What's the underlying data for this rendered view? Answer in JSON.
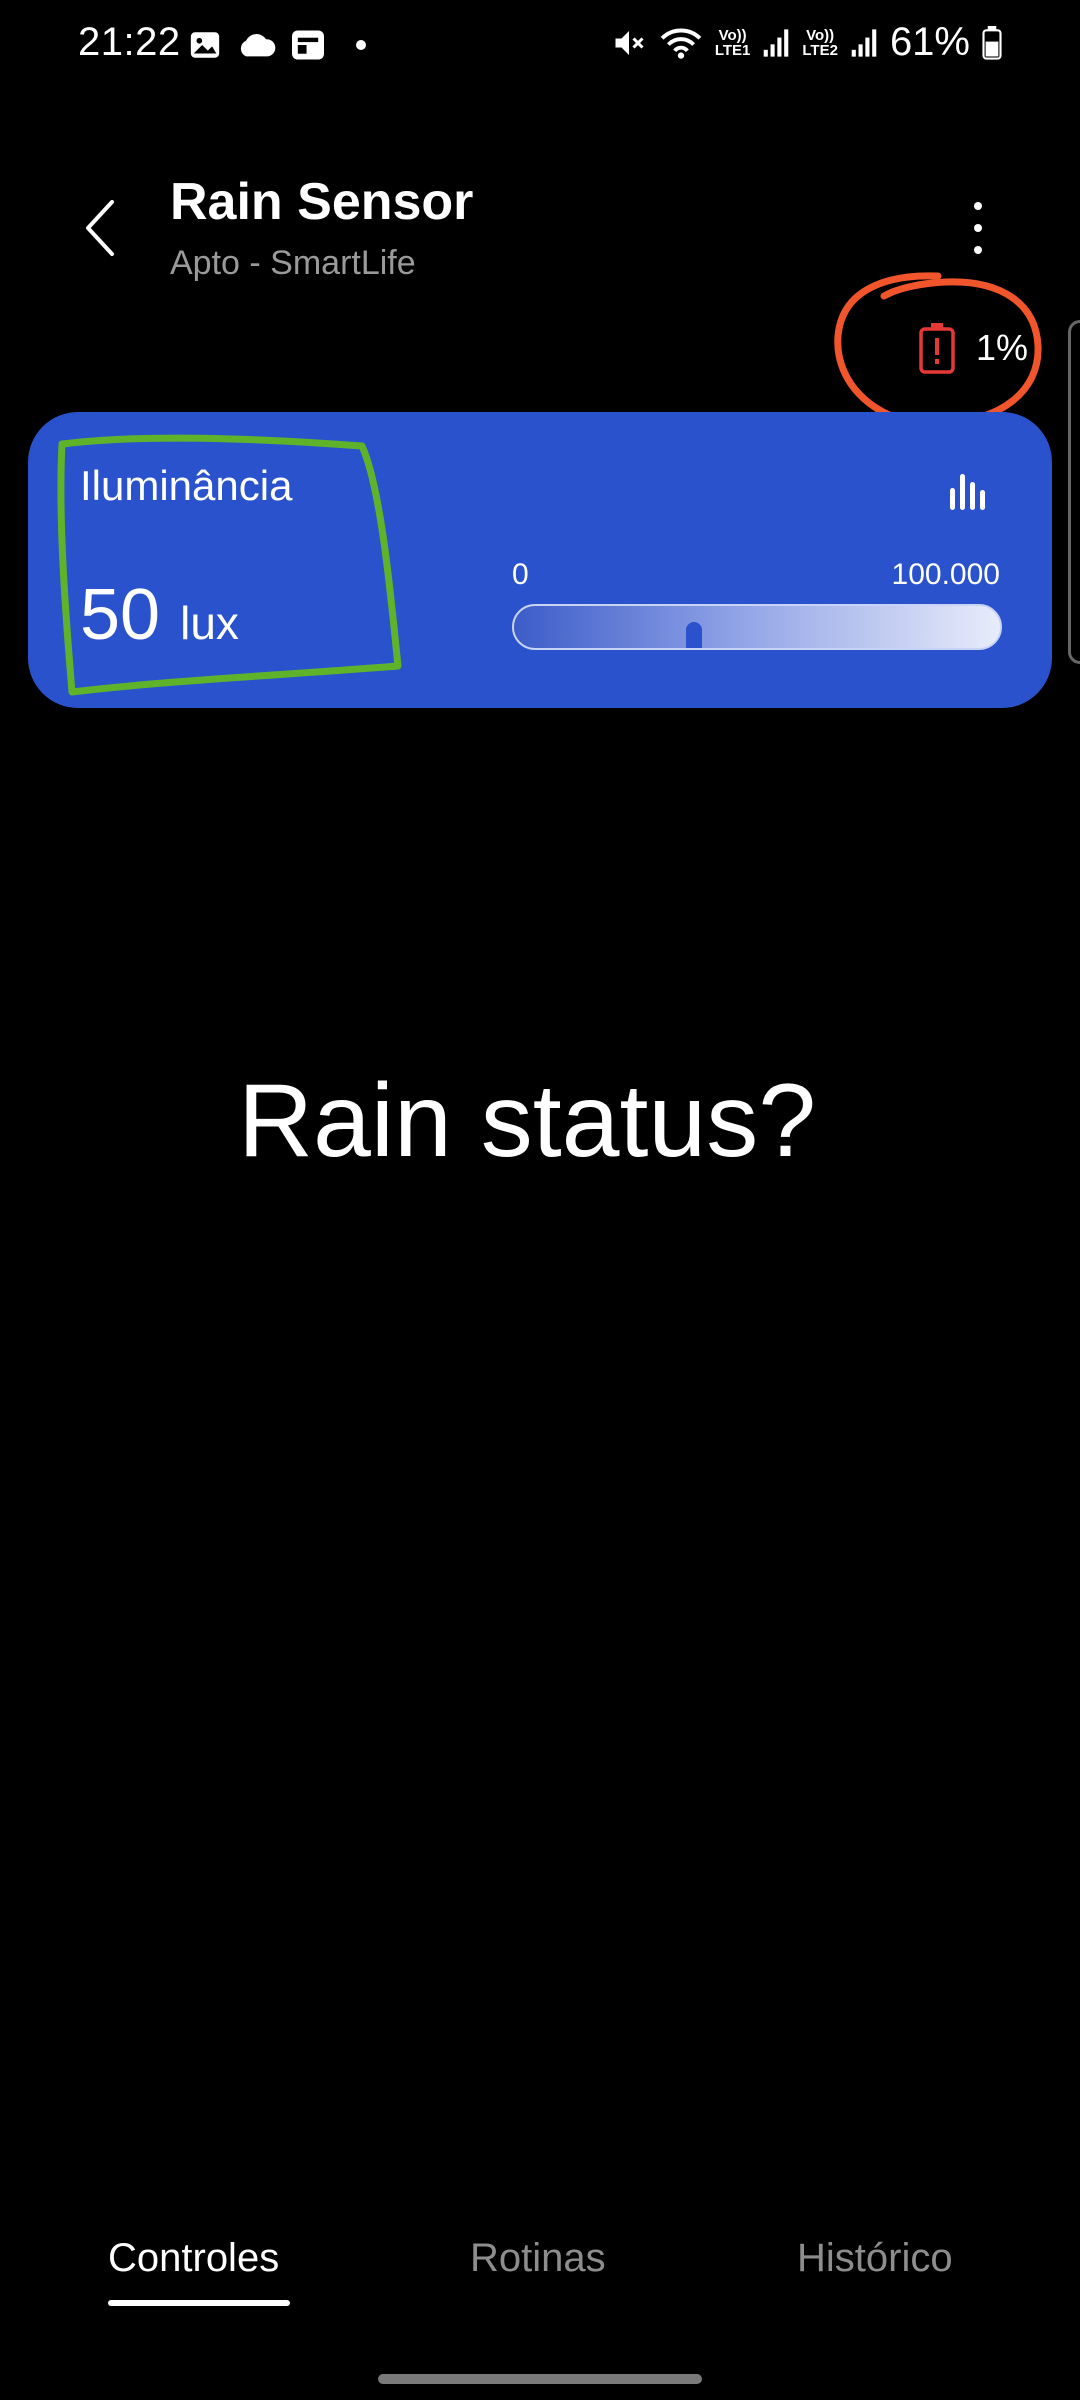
{
  "status_bar": {
    "time": "21:22",
    "battery_percent": "61%",
    "sim1_top": "Vo))",
    "sim1_bottom": "LTE1",
    "sim2_top": "Vo))",
    "sim2_bottom": "LTE2",
    "left_icons": [
      "image-icon",
      "cloud-icon",
      "news-icon",
      "dot-icon"
    ],
    "right_icons": [
      "mute-icon",
      "wifi-icon",
      "signal-icon",
      "signal-icon",
      "battery-icon"
    ]
  },
  "header": {
    "title": "Rain Sensor",
    "subtitle": "Apto - SmartLife"
  },
  "battery_warning": {
    "value": "1%",
    "icon": "battery-alert-icon",
    "color": "#e53935"
  },
  "illuminance": {
    "label": "Iluminância",
    "value": "50",
    "unit": "lux",
    "range_min": "0",
    "range_max": "100.000",
    "level_fraction": 0.37,
    "card_color": "#2a52cc"
  },
  "main": {
    "question": "Rain status?"
  },
  "tabs": [
    {
      "label": "Controles",
      "active": true
    },
    {
      "label": "Rotinas",
      "active": false
    },
    {
      "label": "Histórico",
      "active": false
    }
  ],
  "annotations": {
    "green_color": "#5fb32a",
    "red_color": "#f0552c"
  }
}
